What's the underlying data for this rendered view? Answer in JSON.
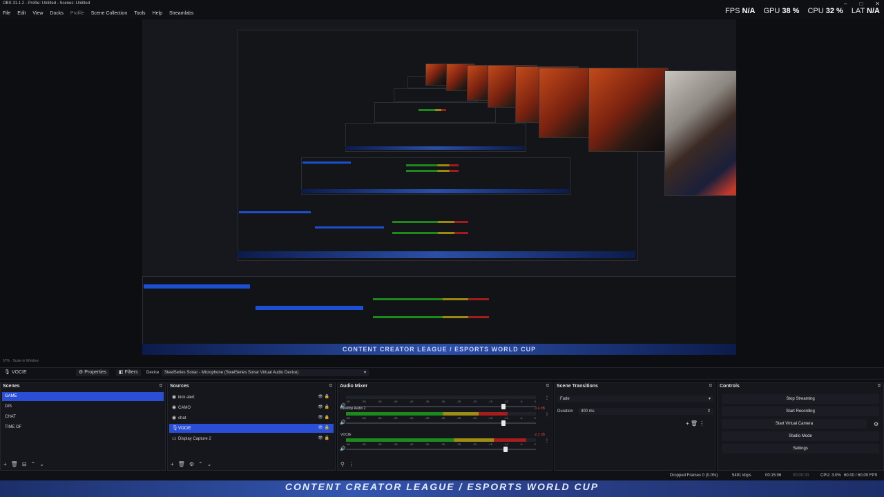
{
  "window": {
    "title": "OBS 31.1.2 - Profile: Untitled - Scenes: Untitled",
    "controls": [
      "–",
      "□",
      "✕"
    ]
  },
  "menu": [
    "File",
    "Edit",
    "View",
    "Docks",
    "Profile",
    "Scene Collection",
    "Tools",
    "Help",
    "Streamlabs"
  ],
  "stats": {
    "fps_label": "FPS",
    "fps_value": "N/A",
    "gpu_label": "GPU",
    "gpu_value": "38 %",
    "cpu_label": "CPU",
    "cpu_value": "32 %",
    "lat_label": "LAT",
    "lat_value": "N/A"
  },
  "preview": {
    "banner_text": "CONTENT CREATOR LEAGUE / ESPORTS WORLD CUP"
  },
  "scale": {
    "text": "57% · Scale to Window"
  },
  "source_bar": {
    "selected_source": "VOCIE",
    "properties_label": "Properties",
    "filters_label": "Filters",
    "device_label": "Device",
    "device_value": "SteelSeries Sonar - Microphone (SteelSeries Sonar Virtual Audio Device)"
  },
  "scenes": {
    "title": "Scenes",
    "items": [
      "GAME",
      "DIS",
      "CHAT",
      "TIME OF"
    ],
    "selected_index": 0
  },
  "sources": {
    "title": "Sources",
    "items": [
      "kick alert",
      "CAMO",
      "chat",
      "VOCIE",
      "Display Capture 2"
    ],
    "selected_index": 3
  },
  "audio_mixer": {
    "title": "Audio Mixer",
    "channels": [
      {
        "name": "",
        "db": "",
        "level": 0.0,
        "fader": 0.83
      },
      {
        "name": "Desktop Audio 2",
        "db": "-3.4 dB",
        "level": 0.85,
        "fader": 0.83
      },
      {
        "name": "VOCIE",
        "db": "-2.2 dB",
        "level": 0.95,
        "fader": 0.84
      }
    ],
    "ticks": [
      "-60",
      "-55",
      "-50",
      "-45",
      "-40",
      "-35",
      "-30",
      "-25",
      "-20",
      "-15",
      "-10",
      "-5",
      "0"
    ]
  },
  "transitions": {
    "title": "Scene Transitions",
    "selected": "Fade",
    "duration_label": "Duration",
    "duration_value": "400 ms"
  },
  "controls": {
    "title": "Controls",
    "buttons": [
      "Stop Streaming",
      "Start Recording",
      "Start Virtual Camera",
      "Studio Mode",
      "Settings"
    ]
  },
  "status": {
    "dropped": "Dropped Frames 0 (0.0%)",
    "bitrate": "5491 kbps",
    "stream_time": "00:15:06",
    "rec_time": "00:00:00",
    "cpu": "CPU: 3.0%",
    "fps": "60.00 / 60.00 FPS"
  },
  "colors": {
    "accent": "#2a4fd6",
    "meter_green": "#1e8a1e",
    "meter_yellow": "#9d8d14",
    "meter_red": "#a51d1d"
  }
}
